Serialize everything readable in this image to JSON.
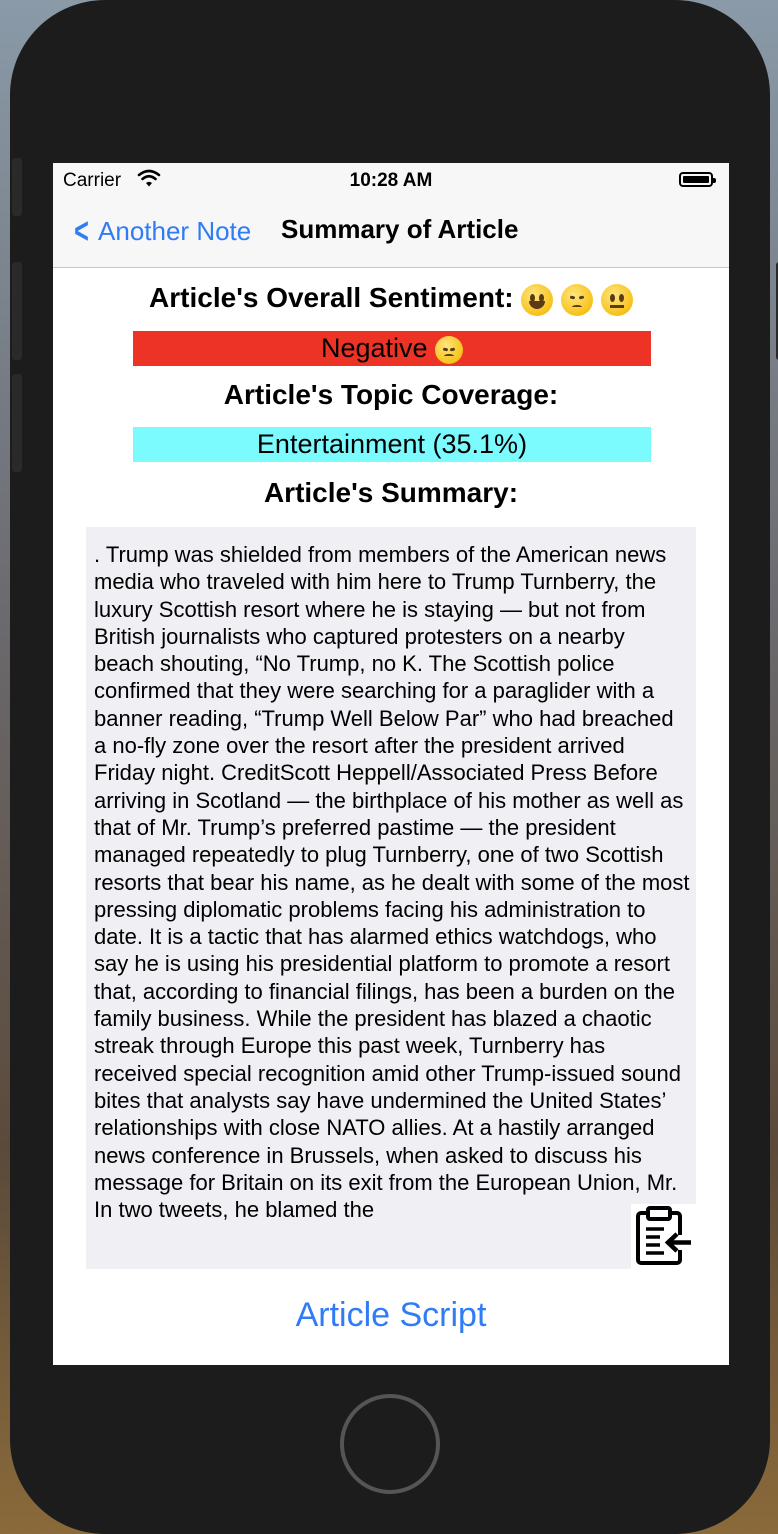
{
  "status_bar": {
    "carrier": "Carrier",
    "time": "10:28 AM"
  },
  "nav": {
    "back_label": "Another Note",
    "title": "Summary of Article"
  },
  "sentiment": {
    "heading": "Article's Overall Sentiment:",
    "heading_emojis": [
      "grinning-face-icon",
      "pensive-face-icon",
      "neutral-face-icon"
    ],
    "label": "Negative",
    "label_emoji": "pensive-face-icon",
    "bar_color": "#ec3326"
  },
  "topic": {
    "heading": "Article's Topic Coverage:",
    "label": "Entertainment (35.1%)",
    "bar_color": "#7cfbff"
  },
  "summary": {
    "heading": "Article's Summary:",
    "text": ".  Trump was shielded from members of the American news media who traveled with him here to Trump Turnberry, the luxury Scottish resort where he is staying — but not from British journalists who captured protesters on a nearby beach shouting, “No Trump, no K.  The Scottish police confirmed that they were searching for a paraglider with a banner reading, “Trump Well Below Par” who had breached a no-fly zone over the resort after the president arrived Friday night. CreditScott Heppell/Associated Press Before arriving in Scotland — the birthplace of his mother as well as that of Mr.  Trump’s preferred pastime — the president managed repeatedly to plug Turnberry, one of two Scottish resorts that bear his name, as he dealt with some of the most pressing diplomatic problems facing his administration to date.  It is a tactic that has alarmed ethics watchdogs, who say he is using his presidential platform to promote a resort that, according to financial filings, has been a burden on the family business.  While the president has blazed a chaotic streak through Europe this past week, Turnberry has received special recognition amid other Trump-issued sound bites that analysts say have undermined the United States’ relationships with close NATO allies.  At a hastily arranged news conference in Brussels, when asked to discuss his message for Britain on its exit from the European Union, Mr.  In two tweets, he blamed the",
    "copy_icon": "clipboard-paste-icon"
  },
  "footer": {
    "link_label": "Article Script"
  }
}
